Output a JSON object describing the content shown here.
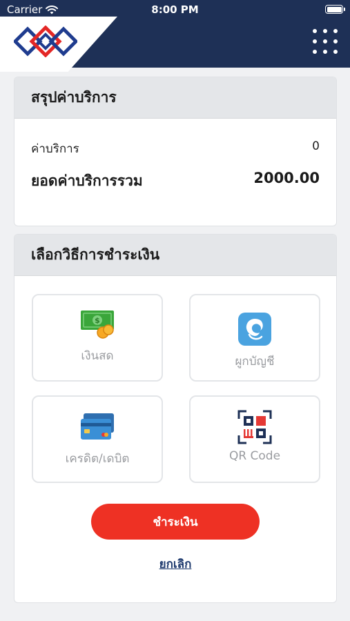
{
  "status_bar": {
    "carrier": "Carrier",
    "time": "8:00 PM"
  },
  "header": {
    "logo_icon": "mrt-logo-icon",
    "menu_icon": "grid-menu-icon"
  },
  "summary": {
    "title": "สรุปค่าบริการ",
    "service_fee_label": "ค่าบริการ",
    "service_fee_value": "0",
    "total_label": "ยอดค่าบริการรวม",
    "total_value": "2000.00"
  },
  "payment": {
    "title": "เลือกวิธีการชำระเงิน",
    "methods": [
      {
        "label": "เงินสด",
        "icon": "cash-icon"
      },
      {
        "label": "ผูกบัญชี",
        "icon": "bank-account-icon"
      },
      {
        "label": "เครดิต/เดบิต",
        "icon": "credit-card-icon"
      },
      {
        "label": "QR Code",
        "icon": "qr-code-icon"
      }
    ],
    "pay_button": "ชำระเงิน",
    "cancel_link": "ยกเลิก"
  },
  "colors": {
    "header_bg": "#1e3056",
    "accent_red": "#ee3124",
    "card_header_bg": "#e4e6e9",
    "link_blue": "#1e3a6e"
  }
}
